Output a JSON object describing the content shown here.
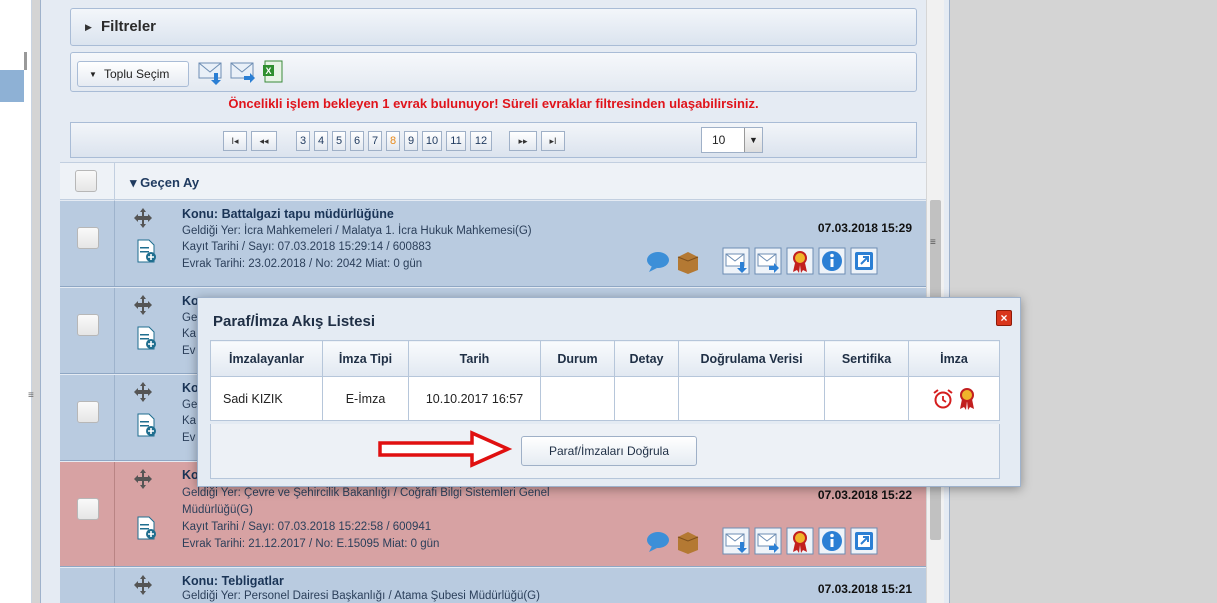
{
  "filters": {
    "label": "Filtreler"
  },
  "toolbar": {
    "bulk_select": "Toplu Seçim"
  },
  "notice": "Öncelikli işlem bekleyen 1 evrak bulunuyor! Süreli evraklar filtresinden ulaşabilirsiniz.",
  "pager": {
    "first": "I◂",
    "prev": "◂◂",
    "pages": [
      "3",
      "4",
      "5",
      "6",
      "7",
      "8",
      "9",
      "10",
      "11",
      "12"
    ],
    "current": "8",
    "next": "▸▸",
    "last": "▸I",
    "page_size": "10"
  },
  "group": {
    "label": "Geçen Ay"
  },
  "rows": [
    {
      "subject": "Konu: Battalgazi tapu müdürlüğüne",
      "from": "Geldiği Yer: İcra Mahkemeleri / Malatya 1. İcra Hukuk Mahkemesi(G)",
      "reg": "Kayıt Tarihi / Sayı: 07.03.2018 15:29:14 / 600883",
      "doc": "Evrak Tarihi: 23.02.2018 / No: 2042 Miat: 0 gün",
      "date": "07.03.2018 15:29"
    },
    {
      "subject": "Ko",
      "from": "Ge",
      "reg": "Ka",
      "doc": "Ev",
      "date": ""
    },
    {
      "subject": "Ko",
      "from": "Ge",
      "reg": "Ka",
      "doc": "Ev",
      "date": ""
    },
    {
      "subject": "Ko",
      "from": "Geldiği Yer: Çevre ve Şehircilik Bakanlığı / Coğrafi Bilgi Sistemleri Genel",
      "from2": "Müdürlüğü(G)",
      "reg": "Kayıt Tarihi / Sayı: 07.03.2018 15:22:58 / 600941",
      "doc": "Evrak Tarihi: 21.12.2017 / No: E.15095 Miat: 0 gün",
      "date": "07.03.2018 15:22"
    },
    {
      "subject": "Konu: Tebligatlar",
      "from": "Geldiği Yer: Personel Dairesi Başkanlığı / Atama Şubesi Müdürlüğü(G)",
      "date": "07.03.2018 15:21"
    }
  ],
  "modal": {
    "title": "Paraf/İmza Akış Listesi",
    "columns": [
      "İmzalayanlar",
      "İmza Tipi",
      "Tarih",
      "Durum",
      "Detay",
      "Doğrulama Verisi",
      "Sertifika",
      "İmza"
    ],
    "rows": [
      {
        "signer": "Sadi KIZIK",
        "type": "E-İmza",
        "date": "10.10.2017 16:57",
        "status": "",
        "detail": "",
        "verify_data": "",
        "certificate": ""
      }
    ],
    "verify_button": "Paraf/İmzaları Doğrula"
  }
}
